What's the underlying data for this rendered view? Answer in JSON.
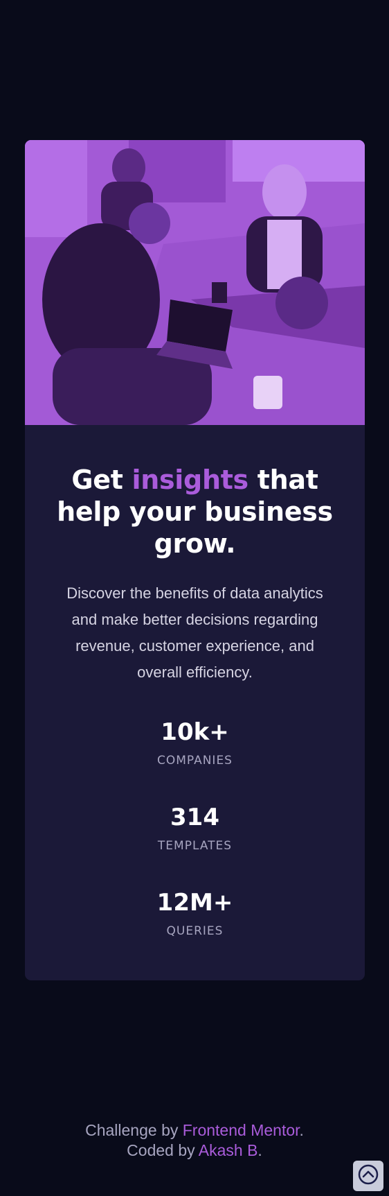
{
  "card": {
    "headline_part1": "Get ",
    "headline_accent": "insights",
    "headline_part2": " that help your business grow.",
    "description": "Discover the benefits of data analytics and make better decisions regarding revenue, customer experience, and overall efficiency.",
    "stats": [
      {
        "value": "10k+",
        "label": "COMPANIES"
      },
      {
        "value": "314",
        "label": "TEMPLATES"
      },
      {
        "value": "12M+",
        "label": "QUERIES"
      }
    ]
  },
  "footer": {
    "line1_prefix": "Challenge by ",
    "line1_link": "Frontend Mentor",
    "line1_suffix": ".",
    "line2_prefix": "Coded by ",
    "line2_link": "Akash B",
    "line2_suffix": "."
  },
  "icons": {
    "scroll_top": "chevron-up-circle-icon"
  },
  "colors": {
    "page_bg": "#090b1a",
    "card_bg": "#1b1938",
    "accent": "#aa5cdb",
    "text_main": "#ffffff",
    "text_muted": "#a7a5c0"
  }
}
